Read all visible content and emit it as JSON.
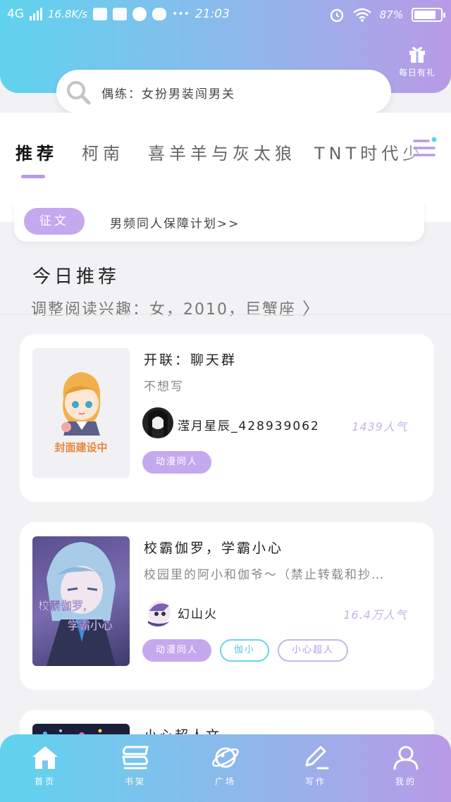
{
  "status_bar": {
    "network": "4G",
    "speed": "16.8K/s",
    "dots": "•••",
    "time": "21:03",
    "battery": "87%"
  },
  "header": {
    "gift_label": "每日有礼",
    "search_placeholder": "偶练：女扮男装闯男关"
  },
  "tabs": [
    {
      "label": "推荐",
      "active": true
    },
    {
      "label": "柯南",
      "active": false
    },
    {
      "label": "喜羊羊与灰太狼",
      "active": false
    },
    {
      "label": "TNT时代少",
      "active": false
    }
  ],
  "notice": {
    "badge": "征文",
    "text": "男频同人保障计划>>"
  },
  "recommend": {
    "title": "今日推荐",
    "subtitle": "调整阅读兴趣：女，2010，巨蟹座",
    "arrow": "〉"
  },
  "books": [
    {
      "title": "开联：聊天群",
      "desc": "不想写",
      "cover_label": "封面建设中",
      "author": "滢月星辰_428939062",
      "popularity": "1439人气",
      "tags": [
        {
          "label": "动漫同人",
          "style": "fill"
        }
      ]
    },
    {
      "title": "校霸伽罗，学霸小心",
      "desc": "校园里的阿小和伽爷～（禁止转载和抄…",
      "cover_label": "",
      "author": "幻山火",
      "popularity": "16.4万人气",
      "tags": [
        {
          "label": "动漫同人",
          "style": "fill"
        },
        {
          "label": "伽小",
          "style": "cyan"
        },
        {
          "label": "小心超人",
          "style": "purple"
        }
      ]
    },
    {
      "title": "小心超人文",
      "desc": "",
      "cover_label": "",
      "author": "",
      "popularity": "",
      "tags": []
    }
  ],
  "bottom_nav": [
    {
      "label": "首页",
      "icon": "home-icon"
    },
    {
      "label": "书架",
      "icon": "bookshelf-icon"
    },
    {
      "label": "广场",
      "icon": "planet-icon"
    },
    {
      "label": "写作",
      "icon": "pen-icon"
    },
    {
      "label": "我的",
      "icon": "user-icon"
    }
  ],
  "colors": {
    "gradient_start": "#5fd3ee",
    "gradient_end": "#b99ae6",
    "accent_purple": "#c5a9ee",
    "accent_cyan": "#52c9de"
  }
}
